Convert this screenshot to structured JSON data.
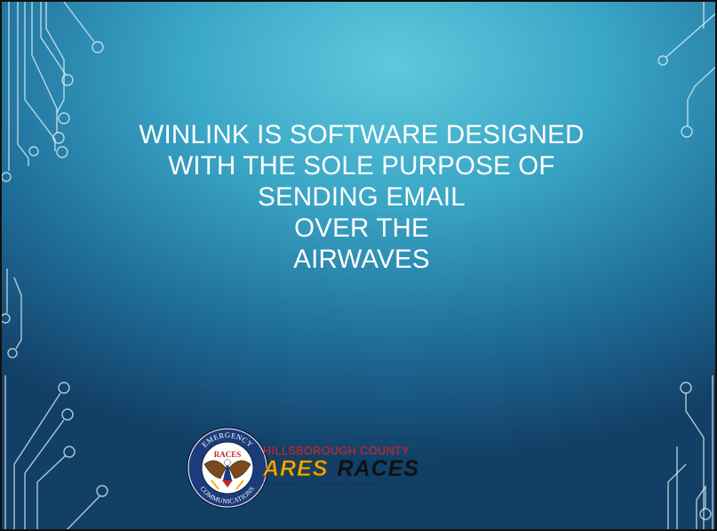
{
  "slide": {
    "title_lines": [
      "WINLINK IS SOFTWARE DESIGNED",
      "WITH THE SOLE PURPOSE OF",
      "SENDING EMAIL",
      "OVER THE",
      "AIRWAVES"
    ]
  },
  "logo": {
    "seal_top_text": "EMERGENCY",
    "seal_center_text": "RACES",
    "seal_bottom_text": "COMMUNICATIONS",
    "county": "HILLSBOROUGH COUNTY",
    "ares": "ARES",
    "races": "RACES",
    "subtitle": "EMERGENCY COMMUNICATIONS"
  },
  "colors": {
    "background_light": "#5ec9dc",
    "background_dark": "#123f66",
    "title_text": "#ffffff",
    "ares_gold": "#f2b01e",
    "county_red": "#c0282d"
  }
}
